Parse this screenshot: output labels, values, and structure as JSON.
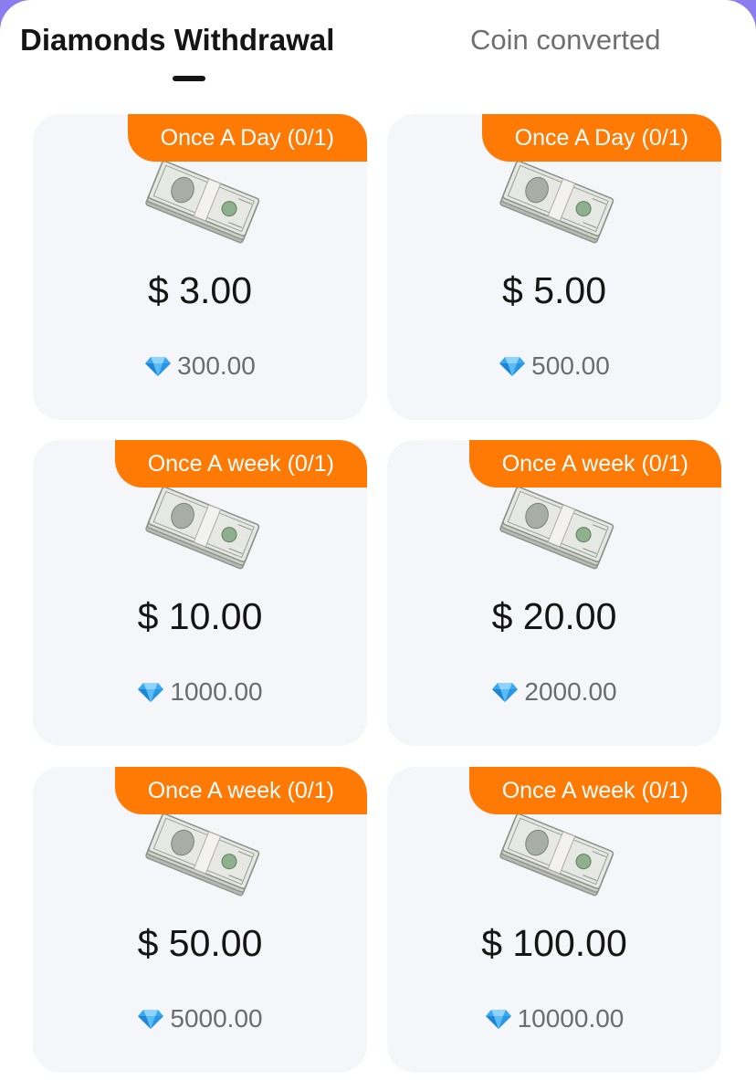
{
  "tabs": [
    {
      "label": "Diamonds Withdrawal",
      "active": true
    },
    {
      "label": "Coin converted",
      "active": false
    }
  ],
  "colors": {
    "accent_orange": "#ff7a05",
    "card_bg": "#f5f6fa",
    "backdrop_purple": "#8d7cf0",
    "gem_blue": "#38a8f0"
  },
  "icons": {
    "cash": "cash-stack-icon",
    "diamond": "diamond-icon"
  },
  "cards": [
    {
      "badge": "Once A Day (0/1)",
      "price": "$ 3.00",
      "cost": "300.00"
    },
    {
      "badge": "Once A Day (0/1)",
      "price": "$ 5.00",
      "cost": "500.00"
    },
    {
      "badge": "Once A week (0/1)",
      "price": "$ 10.00",
      "cost": "1000.00"
    },
    {
      "badge": "Once A week (0/1)",
      "price": "$ 20.00",
      "cost": "2000.00"
    },
    {
      "badge": "Once A week (0/1)",
      "price": "$ 50.00",
      "cost": "5000.00"
    },
    {
      "badge": "Once A week (0/1)",
      "price": "$ 100.00",
      "cost": "10000.00"
    }
  ]
}
